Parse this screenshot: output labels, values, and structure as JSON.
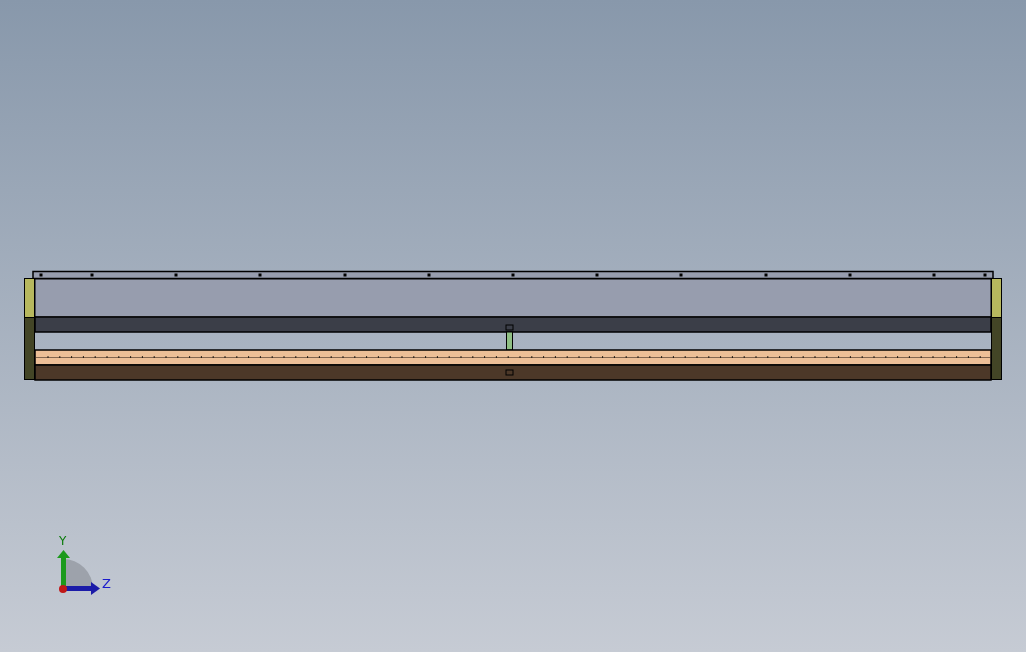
{
  "viewport": {
    "triad": {
      "axis_labels": [
        "Y",
        "Z"
      ]
    }
  }
}
